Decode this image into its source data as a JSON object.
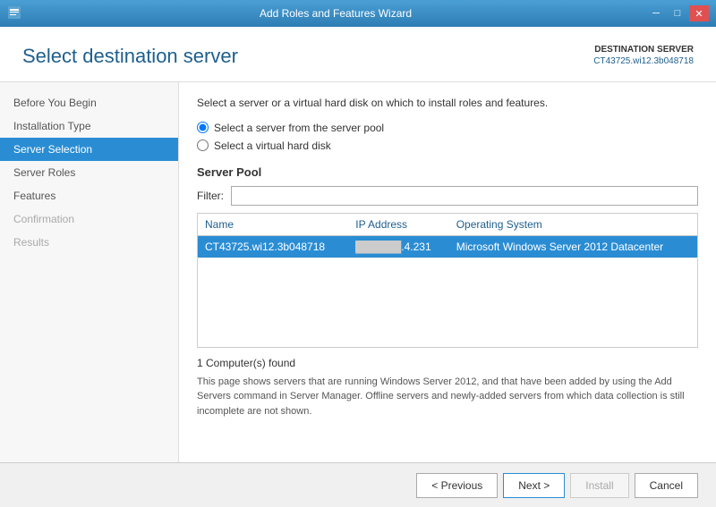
{
  "titlebar": {
    "title": "Add Roles and Features Wizard",
    "icon": "🖥",
    "controls": {
      "minimize": "─",
      "maximize": "□",
      "close": "✕"
    }
  },
  "header": {
    "title": "Select destination server",
    "destination_label": "DESTINATION SERVER",
    "destination_value": "CT43725.wi12.3b048718"
  },
  "sidebar": {
    "items": [
      {
        "label": "Before You Begin",
        "state": "normal"
      },
      {
        "label": "Installation Type",
        "state": "normal"
      },
      {
        "label": "Server Selection",
        "state": "active"
      },
      {
        "label": "Server Roles",
        "state": "normal"
      },
      {
        "label": "Features",
        "state": "normal"
      },
      {
        "label": "Confirmation",
        "state": "disabled"
      },
      {
        "label": "Results",
        "state": "disabled"
      }
    ]
  },
  "content": {
    "instruction": "Select a server or a virtual hard disk on which to install roles and features.",
    "radio_options": [
      {
        "label": "Select a server from the server pool",
        "checked": true
      },
      {
        "label": "Select a virtual hard disk",
        "checked": false
      }
    ],
    "server_pool": {
      "section_label": "Server Pool",
      "filter_label": "Filter:",
      "filter_value": "",
      "table": {
        "columns": [
          "Name",
          "IP Address",
          "Operating System"
        ],
        "rows": [
          {
            "name": "CT43725.wi12.3b048718",
            "ip": "███.███.4.231",
            "os": "Microsoft Windows Server 2012 Datacenter",
            "selected": true
          }
        ]
      },
      "count_text": "1 Computer(s) found",
      "info_text": "This page shows servers that are running Windows Server 2012, and that have been added by using the Add Servers command in Server Manager. Offline servers and newly-added servers from which data collection is still incomplete are not shown."
    }
  },
  "footer": {
    "previous_label": "< Previous",
    "next_label": "Next >",
    "install_label": "Install",
    "cancel_label": "Cancel"
  }
}
